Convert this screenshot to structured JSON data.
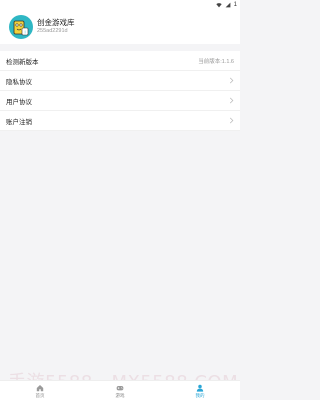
{
  "status_bar": {
    "icons": [
      "wifi-icon",
      "signal-icon"
    ],
    "right_text": "1"
  },
  "profile": {
    "name": "创金游戏库",
    "id": "255ad2291d",
    "avatar_icon": "mascot-avatar-icon",
    "avatar_bg": "#2fb7c4"
  },
  "settings": [
    {
      "label": "检测新版本",
      "value": "当前版本:1.1.6",
      "has_chevron": false
    },
    {
      "label": "隐私协议",
      "value": "",
      "has_chevron": true
    },
    {
      "label": "用户协议",
      "value": "",
      "has_chevron": true
    },
    {
      "label": "账户注销",
      "value": "",
      "has_chevron": true
    }
  ],
  "watermark": "手游5588 · MX5588.COM",
  "tabs": [
    {
      "label": "首页",
      "icon": "home-icon",
      "active": false
    },
    {
      "label": "游戏",
      "icon": "gamepad-icon",
      "active": false
    },
    {
      "label": "我的",
      "icon": "user-icon",
      "active": true
    }
  ],
  "colors": {
    "accent": "#2aa6d6",
    "background": "#f4f4f6"
  }
}
